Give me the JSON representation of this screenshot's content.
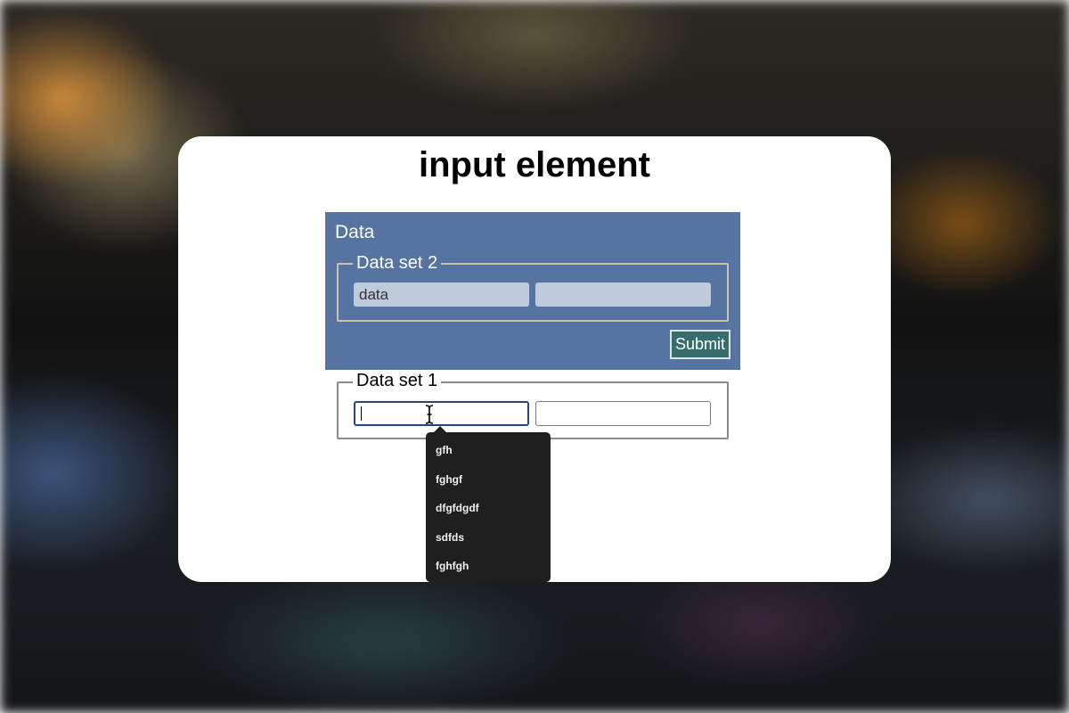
{
  "page": {
    "title": "input element"
  },
  "form_panel": {
    "label": "Data",
    "fieldset": {
      "legend": "Data set 2",
      "inputs": [
        {
          "value": "data",
          "placeholder": ""
        },
        {
          "value": "",
          "placeholder": ""
        }
      ]
    },
    "submit_label": "Submit"
  },
  "outer_fieldset": {
    "legend": "Data set 1",
    "inputs": [
      {
        "value": "",
        "placeholder": "",
        "focused": true
      },
      {
        "value": "",
        "placeholder": ""
      }
    ]
  },
  "autocomplete": {
    "items": [
      "gfh",
      "fghgf",
      "dfgfdgdf",
      "sdfds",
      "fghfgh"
    ]
  },
  "colors": {
    "panel": "#5674a1",
    "submit": "#376e6b",
    "focus_border": "#27457d",
    "dropdown": "#1f1f1f"
  },
  "icons": {
    "cursor": "text-cursor-icon"
  }
}
